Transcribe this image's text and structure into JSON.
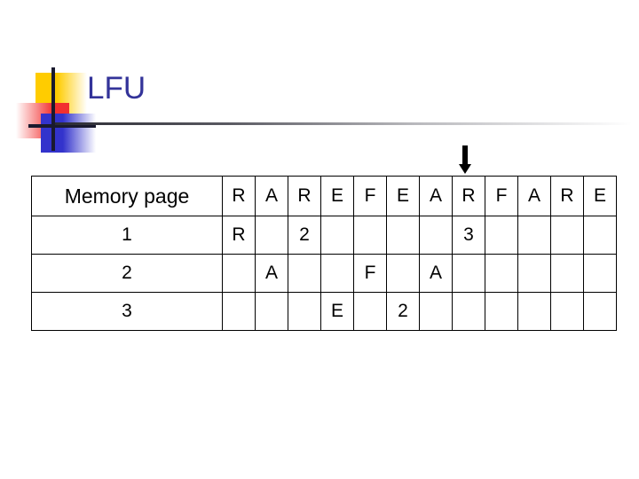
{
  "slide": {
    "title": "LFU",
    "logo": {
      "yellow": "#ffcc00",
      "red": "#f23030",
      "blue": "#3333cc",
      "line": "#1a1a2e"
    },
    "rule_color": "#2b2b33"
  },
  "pointer": {
    "icon": "down-arrow-icon",
    "points_to_column_index": 8,
    "points_to_reference": "R",
    "color": "#000000"
  },
  "table": {
    "header_label": "Memory page",
    "reference_string": [
      "R",
      "A",
      "R",
      "E",
      "F",
      "E",
      "A",
      "R",
      "F",
      "A",
      "R",
      "E"
    ],
    "row_labels": [
      "1",
      "2",
      "3"
    ],
    "colors": {
      "page_letter": "#bb77dd",
      "count": "#b02525",
      "border": "#000000"
    },
    "rows": [
      {
        "label": "1",
        "cells": [
          {
            "text": "R",
            "kind": "page"
          },
          {
            "text": "",
            "kind": "empty"
          },
          {
            "text": "2",
            "kind": "count"
          },
          {
            "text": "",
            "kind": "empty"
          },
          {
            "text": "",
            "kind": "empty"
          },
          {
            "text": "",
            "kind": "empty"
          },
          {
            "text": "",
            "kind": "empty"
          },
          {
            "text": "3",
            "kind": "count"
          },
          {
            "text": "",
            "kind": "empty"
          },
          {
            "text": "",
            "kind": "empty"
          },
          {
            "text": "",
            "kind": "empty"
          },
          {
            "text": "",
            "kind": "empty"
          }
        ]
      },
      {
        "label": "2",
        "cells": [
          {
            "text": "",
            "kind": "empty"
          },
          {
            "text": "A",
            "kind": "page"
          },
          {
            "text": "",
            "kind": "empty"
          },
          {
            "text": "",
            "kind": "empty"
          },
          {
            "text": "F",
            "kind": "page"
          },
          {
            "text": "",
            "kind": "empty"
          },
          {
            "text": "A",
            "kind": "page"
          },
          {
            "text": "",
            "kind": "empty"
          },
          {
            "text": "",
            "kind": "empty"
          },
          {
            "text": "",
            "kind": "empty"
          },
          {
            "text": "",
            "kind": "empty"
          },
          {
            "text": "",
            "kind": "empty"
          }
        ]
      },
      {
        "label": "3",
        "cells": [
          {
            "text": "",
            "kind": "empty"
          },
          {
            "text": "",
            "kind": "empty"
          },
          {
            "text": "",
            "kind": "empty"
          },
          {
            "text": "E",
            "kind": "page"
          },
          {
            "text": "",
            "kind": "empty"
          },
          {
            "text": "2",
            "kind": "count"
          },
          {
            "text": "",
            "kind": "empty"
          },
          {
            "text": "",
            "kind": "empty"
          },
          {
            "text": "",
            "kind": "empty"
          },
          {
            "text": "",
            "kind": "empty"
          },
          {
            "text": "",
            "kind": "empty"
          },
          {
            "text": "",
            "kind": "empty"
          }
        ]
      }
    ]
  }
}
